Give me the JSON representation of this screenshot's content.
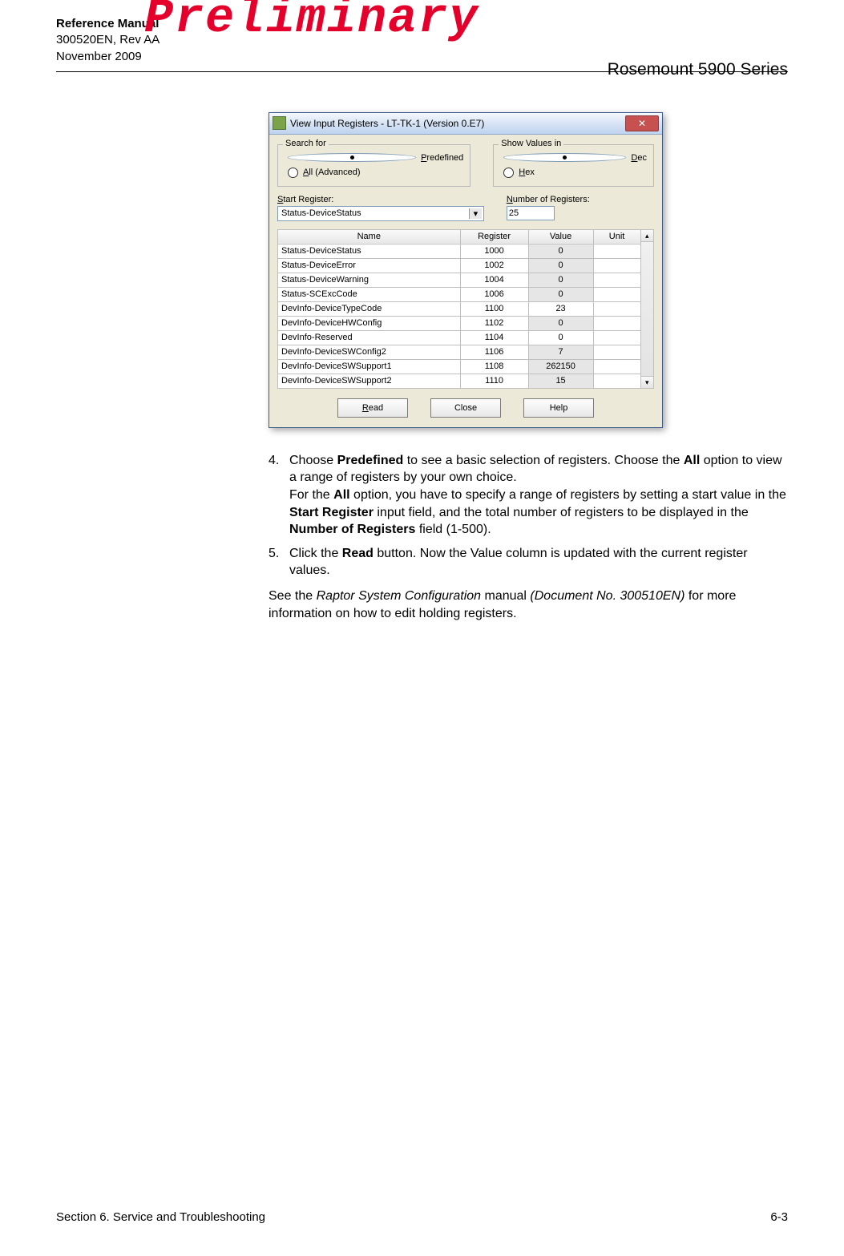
{
  "watermark": "Preliminary",
  "header": {
    "manual_title": "Reference Manual",
    "doc_number": "300520EN, Rev AA",
    "date": "November 2009",
    "product": "Rosemount 5900 Series"
  },
  "dialog": {
    "title": "View Input Registers - LT-TK-1 (Version 0.E7)",
    "search_for": {
      "legend": "Search for",
      "predefined_u": "P",
      "predefined_rest": "redefined",
      "all_u": "A",
      "all_rest": "ll  (Advanced)"
    },
    "show_values": {
      "legend": "Show Values in",
      "dec_u": "D",
      "dec_rest": "ec",
      "hex_u": "H",
      "hex_rest": "ex"
    },
    "start_register": {
      "label_u": "S",
      "label_rest": "tart Register:",
      "value": "Status-DeviceStatus"
    },
    "number_of_registers": {
      "label_u": "N",
      "label_rest": "umber of Registers:",
      "value": "25"
    },
    "columns": [
      "Name",
      "Register",
      "Value",
      "Unit"
    ],
    "rows": [
      {
        "name": "Status-DeviceStatus",
        "register": "1000",
        "value": "0",
        "unit": "",
        "hl": true
      },
      {
        "name": "Status-DeviceError",
        "register": "1002",
        "value": "0",
        "unit": "",
        "hl": true
      },
      {
        "name": "Status-DeviceWarning",
        "register": "1004",
        "value": "0",
        "unit": "",
        "hl": true
      },
      {
        "name": "Status-SCExcCode",
        "register": "1006",
        "value": "0",
        "unit": "",
        "hl": true
      },
      {
        "name": "DevInfo-DeviceTypeCode",
        "register": "1100",
        "value": "23",
        "unit": "",
        "hl": false
      },
      {
        "name": "DevInfo-DeviceHWConfig",
        "register": "1102",
        "value": "0",
        "unit": "",
        "hl": true
      },
      {
        "name": "DevInfo-Reserved",
        "register": "1104",
        "value": "0",
        "unit": "",
        "hl": false
      },
      {
        "name": "DevInfo-DeviceSWConfig2",
        "register": "1106",
        "value": "7",
        "unit": "",
        "hl": true
      },
      {
        "name": "DevInfo-DeviceSWSupport1",
        "register": "1108",
        "value": "262150",
        "unit": "",
        "hl": true
      },
      {
        "name": "DevInfo-DeviceSWSupport2",
        "register": "1110",
        "value": "15",
        "unit": "",
        "hl": true
      }
    ],
    "buttons": {
      "read_u": "R",
      "read_rest": "ead",
      "close": "Close",
      "help": "Help"
    }
  },
  "steps": [
    {
      "marker": "4.",
      "t1": "Choose ",
      "b1": "Predefined",
      "t2": " to see a basic selection of registers. Choose the ",
      "b2": "All",
      "t3": " option to view a range of registers by your own choice.",
      "t4": "For the ",
      "b3": "All",
      "t5": " option, you have to specify a range of registers by setting a start value in the ",
      "b4": "Start Register",
      "t6": " input field, and the total number of registers to be displayed in the ",
      "b5": "Number of Registers",
      "t7": " field (1-500)."
    },
    {
      "marker": "5.",
      "t1": "Click the ",
      "b1": "Read",
      "t2": " button. Now the Value column is updated with the current register values."
    }
  ],
  "ref": {
    "t1": "See the ",
    "i1": "Raptor System Configuration",
    "t2": " manual ",
    "i2": "(Document No. 300510EN)",
    "t3": " for more information on how to edit holding registers."
  },
  "footer": {
    "section": "Section 6. Service and Troubleshooting",
    "page": "6-3"
  }
}
